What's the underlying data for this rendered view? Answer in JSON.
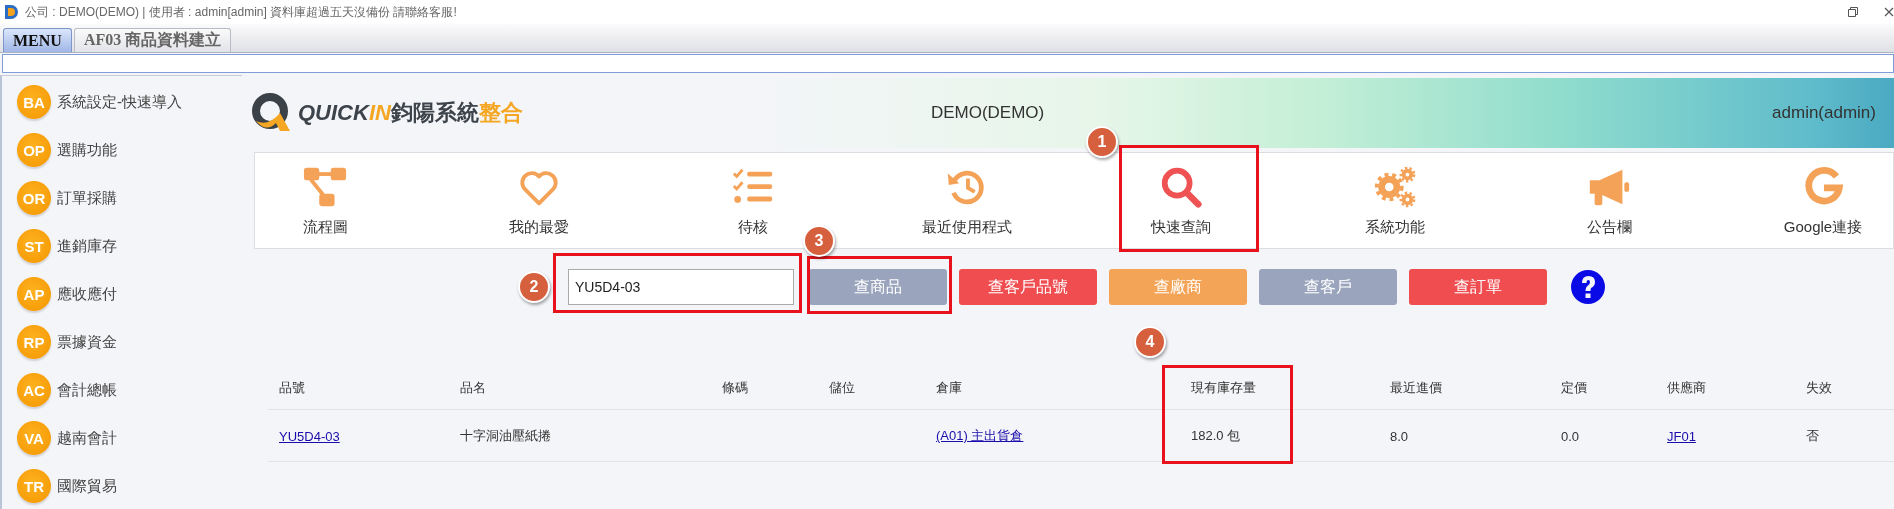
{
  "title_bar": {
    "text": "公司 : DEMO(DEMO) | 使用者 : admin[admin] 資料庫超過五天沒備份 請聯絡客服!"
  },
  "tabs": [
    {
      "label": "MENU",
      "selected": true
    },
    {
      "label": "AF03 商品資料建立",
      "selected": false
    }
  ],
  "sidebar": {
    "items": [
      {
        "code": "BA",
        "label": "系統設定-快速導入"
      },
      {
        "code": "OP",
        "label": "選購功能"
      },
      {
        "code": "OR",
        "label": "訂單採購"
      },
      {
        "code": "ST",
        "label": "進銷庫存"
      },
      {
        "code": "AP",
        "label": "應收應付"
      },
      {
        "code": "RP",
        "label": "票據資金"
      },
      {
        "code": "AC",
        "label": "會計總帳"
      },
      {
        "code": "VA",
        "label": "越南會計"
      },
      {
        "code": "TR",
        "label": "國際貿易"
      }
    ]
  },
  "header": {
    "logo": {
      "brand": "QUICK",
      "brand_accent": "IN",
      "name": "鈞陽系統",
      "name_accent": "整合"
    },
    "company": "DEMO(DEMO)",
    "user": "admin(admin)"
  },
  "tiles": [
    {
      "label": "流程圖",
      "selected": false,
      "highlighted": false
    },
    {
      "label": "我的最愛",
      "selected": false,
      "highlighted": false
    },
    {
      "label": "待核",
      "selected": false,
      "highlighted": false
    },
    {
      "label": "最近使用程式",
      "selected": false,
      "highlighted": false
    },
    {
      "label": "快速查詢",
      "selected": true,
      "highlighted": true,
      "marker": "1"
    },
    {
      "label": "系統功能",
      "selected": false,
      "highlighted": false
    },
    {
      "label": "公告欄",
      "selected": false,
      "highlighted": false
    },
    {
      "label": "Google連接",
      "selected": false,
      "highlighted": false
    }
  ],
  "search": {
    "value": "YU5D4-03",
    "highlighted": true,
    "marker": "2"
  },
  "search_buttons": [
    {
      "label": "查商品",
      "color": "#9aa5bd",
      "highlighted": true,
      "marker": "3"
    },
    {
      "label": "查客戶品號",
      "color": "#ef4d50",
      "highlighted": false
    },
    {
      "label": "查廠商",
      "color": "#f4a457",
      "highlighted": false
    },
    {
      "label": "查客戶",
      "color": "#9aa5bd",
      "highlighted": false
    },
    {
      "label": "查訂單",
      "color": "#ef4d50",
      "highlighted": false
    }
  ],
  "table": {
    "columns": [
      {
        "label": "品號",
        "highlighted": false
      },
      {
        "label": "品名",
        "highlighted": false
      },
      {
        "label": "條碼",
        "highlighted": false
      },
      {
        "label": "儲位",
        "highlighted": false
      },
      {
        "label": "倉庫",
        "highlighted": false
      },
      {
        "label": "現有庫存量",
        "highlighted": true,
        "marker": "4"
      },
      {
        "label": "最近進價",
        "highlighted": false
      },
      {
        "label": "定價",
        "highlighted": false
      },
      {
        "label": "供應商",
        "highlighted": false
      },
      {
        "label": "失效",
        "highlighted": false
      }
    ],
    "rows": [
      {
        "cells": [
          {
            "text": "YU5D4-03",
            "link": true
          },
          {
            "text": "十字洞油壓紙捲",
            "link": false
          },
          null,
          null,
          {
            "text": "(A01) 主出貨倉",
            "link": true
          },
          {
            "text": "182.0 包",
            "link": false
          },
          {
            "text": "8.0",
            "link": false
          },
          {
            "text": "0.0",
            "link": false
          },
          {
            "text": "JF01",
            "link": true
          },
          {
            "text": "否",
            "link": false
          }
        ]
      }
    ]
  }
}
